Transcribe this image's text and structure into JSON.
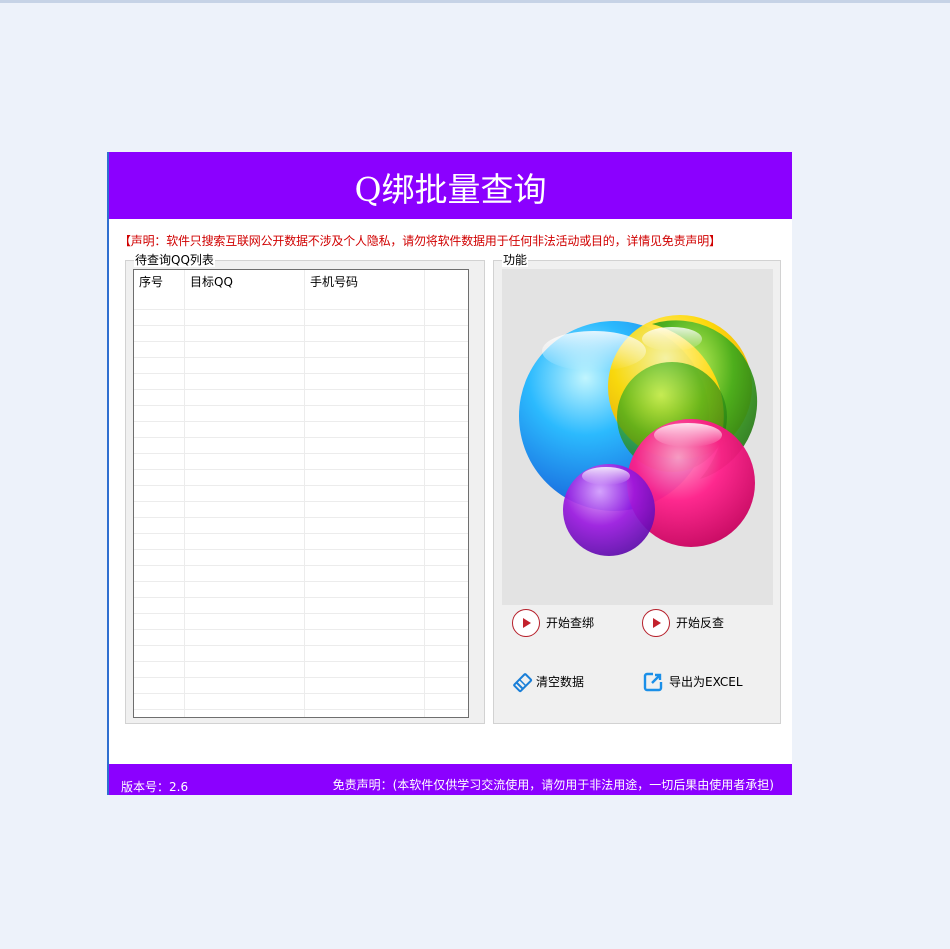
{
  "app": {
    "title": "Q绑批量查询",
    "notice": "【声明：软件只搜索互联网公开数据不涉及个人隐私，请勿将软件数据用于任何非法活动或目的，详情见免责声明】"
  },
  "list_group": {
    "title": "待查询QQ列表",
    "columns": [
      "序号",
      "目标QQ",
      "手机号码"
    ],
    "rows": []
  },
  "function_group": {
    "title": "功能",
    "buttons": {
      "start_bind": "开始查绑",
      "start_reverse": "开始反查",
      "clear_data": "清空数据",
      "export_excel": "导出为EXCEL"
    },
    "icons": {
      "start_bind": "play-icon",
      "start_reverse": "play-icon",
      "clear_data": "clear-icon",
      "export_excel": "export-icon"
    }
  },
  "footer": {
    "version": "版本号：2.6",
    "disclaimer": "免责声明：(本软件仅供学习交流使用，请勿用于非法用途，一切后果由使用者承担)"
  },
  "colors": {
    "brand": "#8b00ff",
    "notice": "#d00000",
    "background": "#edf2fa"
  }
}
